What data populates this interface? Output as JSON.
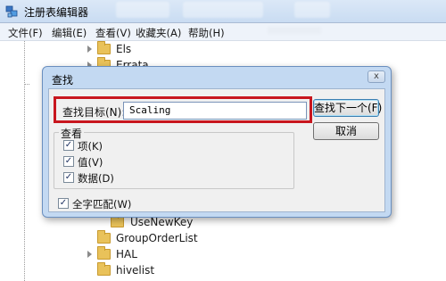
{
  "window": {
    "title": "注册表编辑器",
    "icon": "regedit-icon"
  },
  "menu": {
    "items": [
      {
        "label": "文件(F)"
      },
      {
        "label": "编辑(E)"
      },
      {
        "label": "查看(V)"
      },
      {
        "label": "收藏夹(A)"
      },
      {
        "label": "帮助(H)"
      }
    ]
  },
  "tree": {
    "items_above": [
      {
        "label": "Els"
      },
      {
        "label": "Errata"
      }
    ],
    "items_below": [
      {
        "label": "UseNewKey"
      },
      {
        "label": "GroupOrderList"
      },
      {
        "label": "HAL"
      },
      {
        "label": "hivelist"
      }
    ]
  },
  "dialog": {
    "title": "查找",
    "close_glyph": "x",
    "find_label": "查找目标(N):",
    "find_value": "Scaling",
    "find_next_label": "查找下一个(F)",
    "cancel_label": "取消",
    "look_at_title": "查看",
    "options": [
      {
        "label": "项(K)",
        "checked": true
      },
      {
        "label": "值(V)",
        "checked": true
      },
      {
        "label": "数据(D)",
        "checked": true
      }
    ],
    "match_whole_label": "全字匹配(W)",
    "match_whole_checked": true,
    "check_glyph": "✓",
    "highlight_color": "#c8161e"
  }
}
